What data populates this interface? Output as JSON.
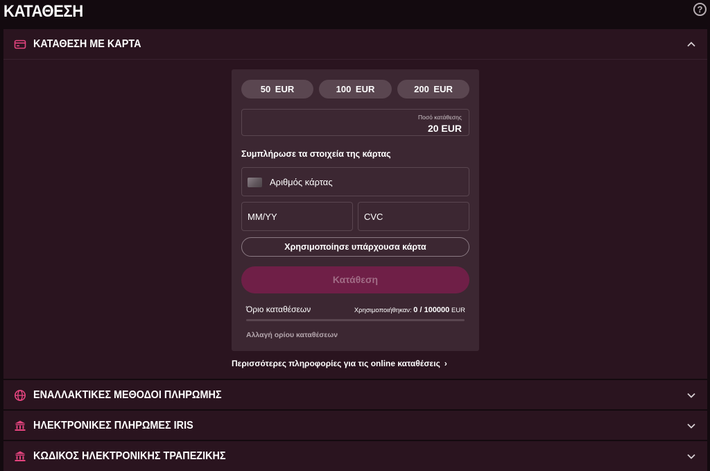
{
  "page": {
    "title": "ΚΑΤΑΘΕΣΗ",
    "help_label": "?"
  },
  "sections": {
    "card": {
      "title": "ΚΑΤΑΘΕΣΗ ΜΕ ΚΑΡΤΑ",
      "expanded": true,
      "amount_chips": [
        "50  EUR",
        "100  EUR",
        "200  EUR"
      ],
      "amount_label": "Ποσό κατάθεσης",
      "amount_value": "20 EUR",
      "fill_heading": "Συμπλήρωσε τα στοιχεία της κάρτας",
      "card_number_placeholder": "Αριθμός κάρτας",
      "expiry_placeholder": "MM/YY",
      "cvc_placeholder": "CVC",
      "use_existing_label": "Χρησιμοποίησε υπάρχουσα κάρτα",
      "deposit_button_label": "Κατάθεση",
      "limit_label": "Όριο καταθέσεων",
      "limit_used_prefix": "Χρησιμοποιήθηκαν:",
      "limit_used_value": "0 / 100000",
      "limit_currency": "EUR",
      "limit_progress": 0,
      "change_limit_label": "Αλλαγή ορίου καταθέσεων",
      "more_info_label": "Περισσότερες πληροφορίες για τις online καταθέσεις"
    },
    "alternative": {
      "title": "ΕΝΑΛΛΑΚΤΙΚΕΣ ΜΕΘΟΔΟΙ ΠΛΗΡΩΜΗΣ",
      "expanded": false
    },
    "iris": {
      "title": "ΗΛΕΚΤΡΟΝΙΚΕΣ ΠΛΗΡΩΜΕΣ IRIS",
      "expanded": false
    },
    "ebanking": {
      "title": "ΚΩΔΙΚΟΣ ΗΛΕΚΤΡΟΝΙΚΗΣ ΤΡΑΠΕΖΙΚΗΣ",
      "expanded": false
    }
  },
  "colors": {
    "background": "#130a0f",
    "panel": "#2a141f",
    "card": "#3c2732",
    "accent_icon": "#e5447f",
    "deposit_button": "#6f1f47"
  },
  "icons": {
    "card_section": "credit-card-icon",
    "alternative_section": "globe-icon",
    "iris_section": "bank-icon",
    "ebanking_section": "bank-icon"
  }
}
